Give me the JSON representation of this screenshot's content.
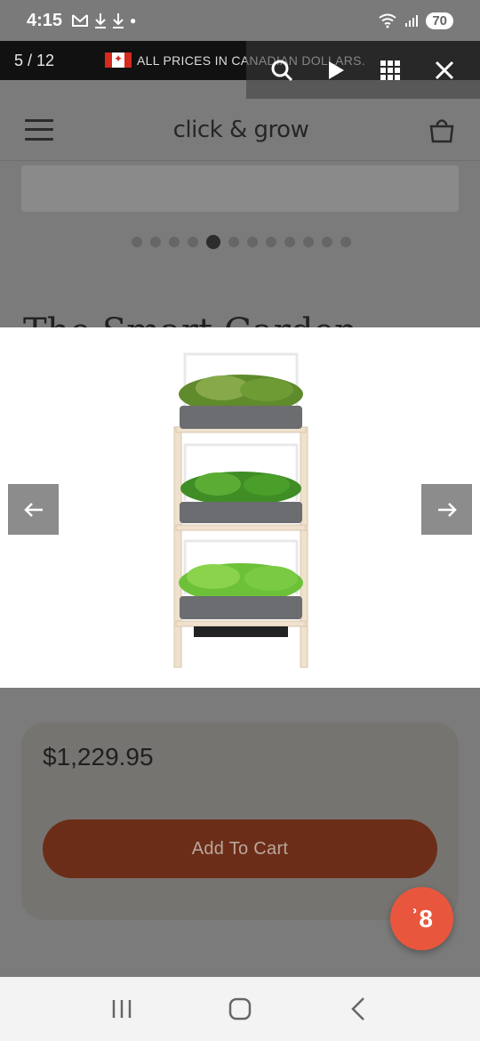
{
  "status_bar": {
    "time": "4:15",
    "battery": "70"
  },
  "banner": {
    "counter": "5 / 12",
    "text": "ALL PRICES IN CANADIAN DOLLARS."
  },
  "header": {
    "logo": "click & grow"
  },
  "carousel": {
    "total_dots": 12,
    "active_index": 4
  },
  "partial_title": "The Smart Garden",
  "product": {
    "price": "$1,229.95",
    "add_to_cart": "Add To Cart"
  },
  "chat": {
    "badge": "ʾ8"
  },
  "colors": {
    "accent_button": "#6c2d18",
    "chat_fab": "#e8573d"
  },
  "icons": [
    "search-icon",
    "play-icon",
    "grid-icon",
    "close-icon",
    "hamburger-icon",
    "cart-icon",
    "arrow-left-icon",
    "arrow-right-icon",
    "nav-recent-icon",
    "nav-home-icon",
    "nav-back-icon"
  ]
}
